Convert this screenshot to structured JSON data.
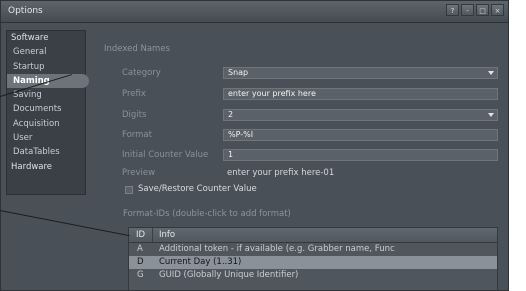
{
  "window": {
    "title": "Options",
    "controls": [
      "?",
      "-",
      "□",
      "×"
    ]
  },
  "sidebar": [
    {
      "label": "Software",
      "type": "group"
    },
    {
      "label": "General",
      "type": "child"
    },
    {
      "label": "Startup",
      "type": "child"
    },
    {
      "label": "Naming",
      "type": "child",
      "active": true
    },
    {
      "label": "Saving",
      "type": "child"
    },
    {
      "label": "Documents",
      "type": "child"
    },
    {
      "label": "Acquisition",
      "type": "child"
    },
    {
      "label": "User",
      "type": "child"
    },
    {
      "label": "DataTables",
      "type": "child"
    },
    {
      "label": "Hardware",
      "type": "group"
    }
  ],
  "section": {
    "title": "Indexed Names"
  },
  "fields": {
    "category": {
      "label": "Category",
      "value": "Snap"
    },
    "prefix": {
      "label": "Prefix",
      "value": "enter your prefix here"
    },
    "digits": {
      "label": "Digits",
      "value": "2"
    },
    "format": {
      "label": "Format",
      "value": "%P-%I"
    },
    "initial_counter": {
      "label": "Initial Counter Value",
      "value": "1"
    },
    "preview": {
      "label": "Preview",
      "value": "enter your prefix here-01"
    }
  },
  "save_restore": {
    "label": "Save/Restore Counter Value",
    "checked": false
  },
  "format_ids": {
    "title": "Format-IDs (double-click to add format)",
    "columns": [
      "ID",
      "Info"
    ],
    "rows": [
      {
        "id": "A",
        "info": "Additional token - if available (e.g. Grabber name, Func",
        "selected": false
      },
      {
        "id": "D",
        "info": "Current Day (1..31)",
        "selected": true
      },
      {
        "id": "G",
        "info": "GUID (Globally Unique Identifier)",
        "selected": false
      }
    ]
  }
}
